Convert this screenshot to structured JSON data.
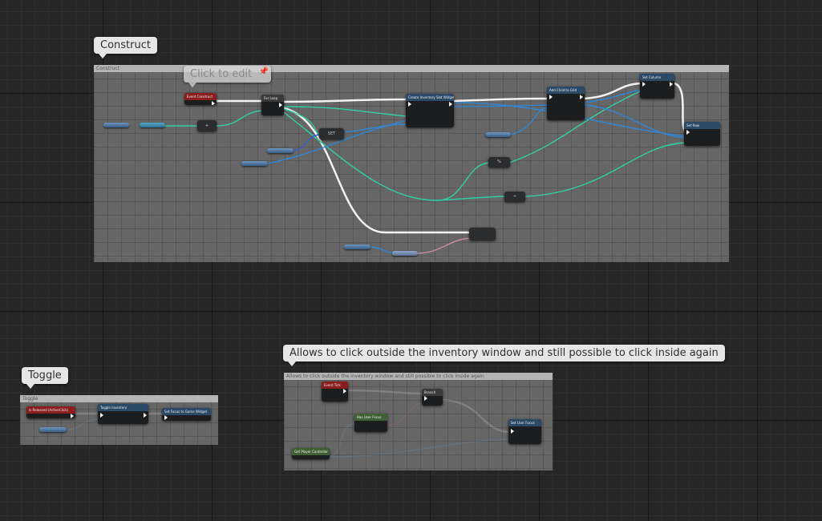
{
  "comments": {
    "construct": {
      "bubble": "Construct",
      "header": "Construct"
    },
    "toggle": {
      "bubble": "Toggle",
      "header": "Toggle"
    },
    "focus": {
      "bubble": "Allows to click outside the inventory window and still possible to click inside again",
      "header": "Allows to click outside the inventory window and still possible to click inside again"
    }
  },
  "click_to_edit": "Click to edit",
  "pin_glyph": "📌",
  "nodes": {
    "event_construct": "Event Construct",
    "for_loop": "For Loop",
    "set": "SET",
    "create_widget": "Create Inventory Slot Widget",
    "add_child": "Add Child to Grid",
    "set_column": "Set Column",
    "set_row": "Set Row",
    "percent": "%",
    "divide": "÷",
    "add": "+",
    "is_released": "Is Released (ActionClick)",
    "toggle_inventory": "Toggle Inventory",
    "set_focus_current": "Set Focus to Game Widget",
    "event_tick": "Event Tick",
    "branch": "Branch",
    "has_user_focus": "Has User Focus",
    "get_player_controller": "Get Player Controller",
    "set_user_focus": "Set User Focus"
  }
}
